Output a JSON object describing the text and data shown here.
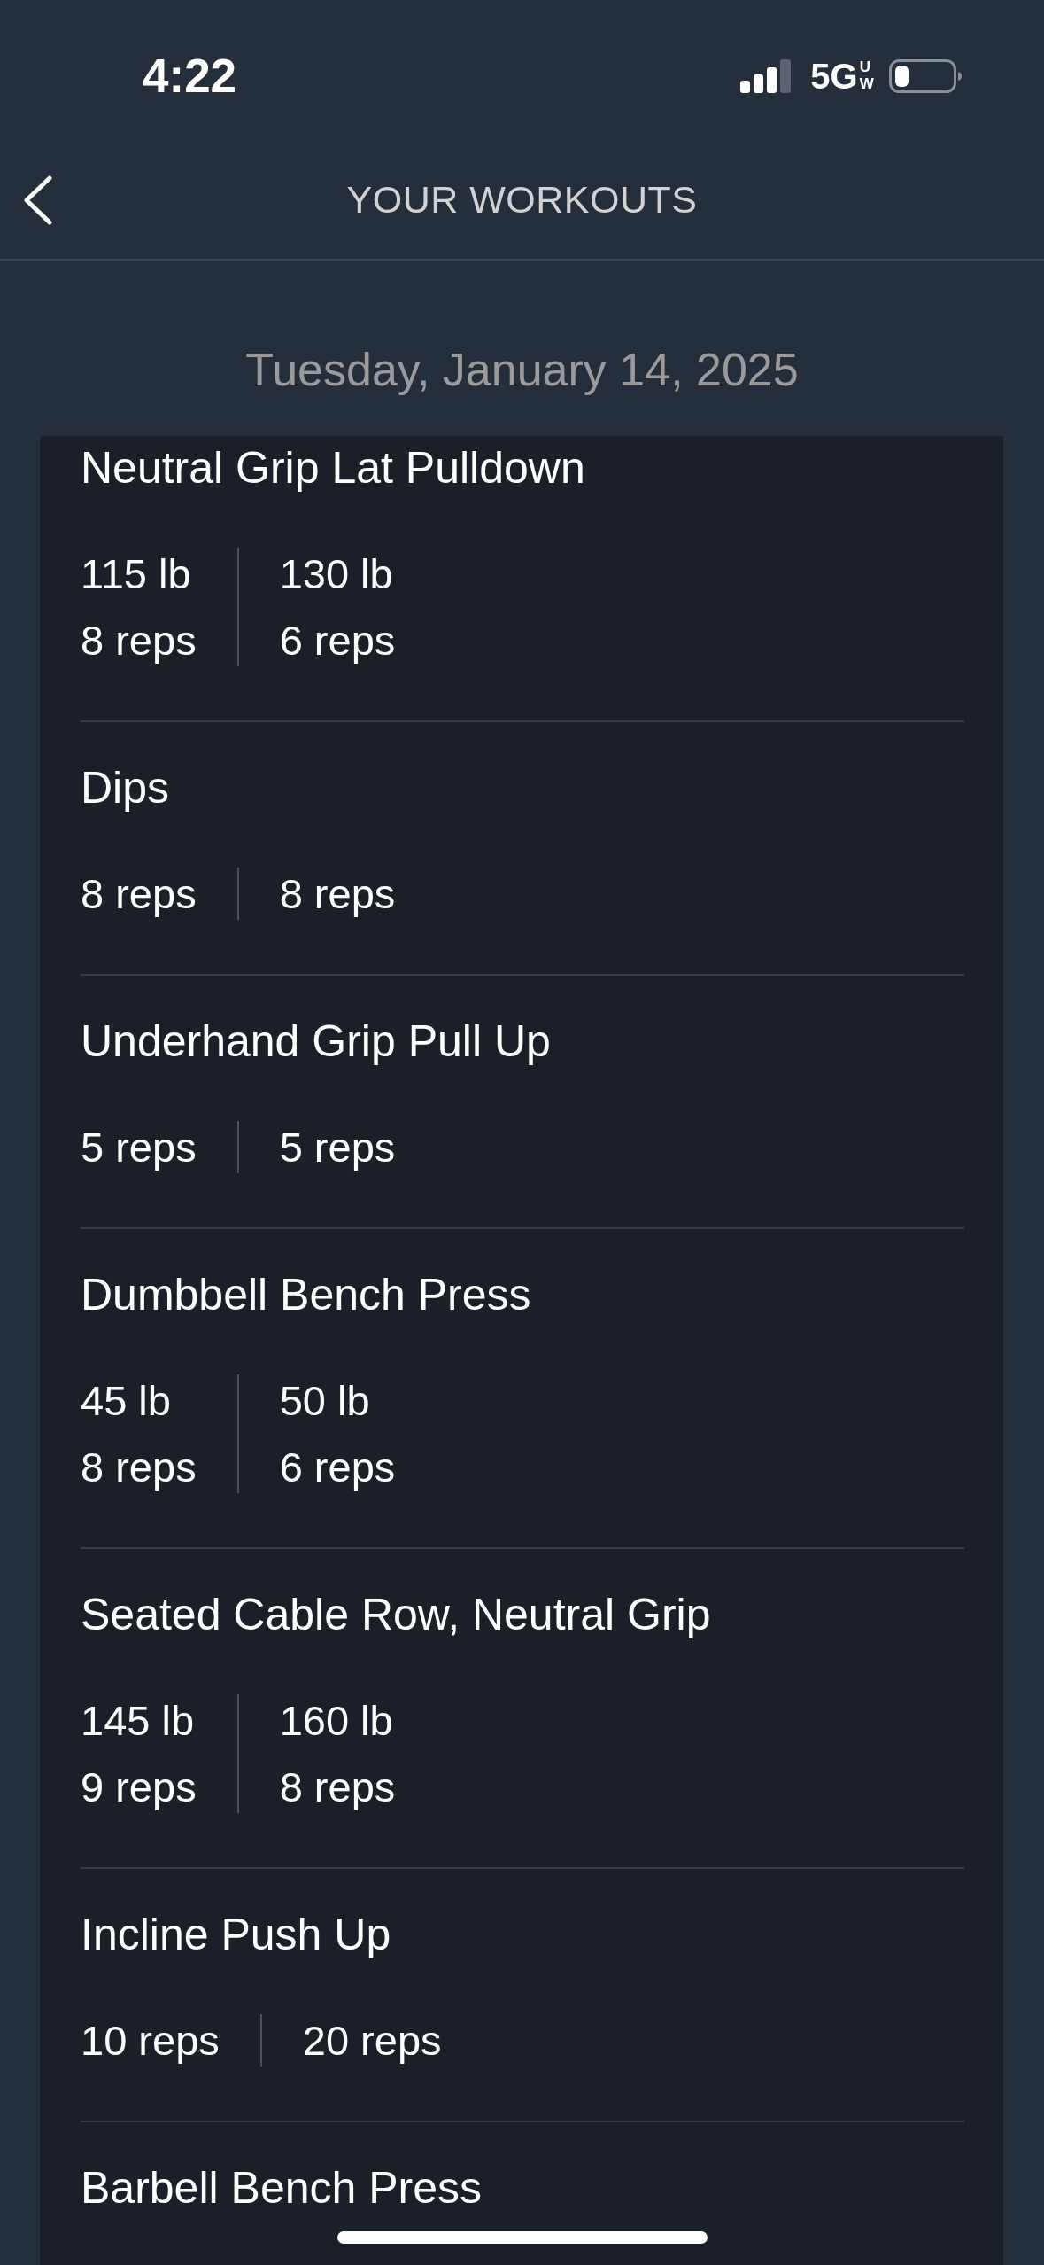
{
  "status_bar": {
    "time": "4:22",
    "network": "5G",
    "network_suffix": "UW"
  },
  "header": {
    "title": "YOUR WORKOUTS"
  },
  "date": "Tuesday, January 14, 2025",
  "exercises": [
    {
      "name": "Neutral Grip Lat Pulldown",
      "sets": [
        {
          "weight": "115 lb",
          "reps": "8 reps"
        },
        {
          "weight": "130 lb",
          "reps": "6 reps"
        }
      ]
    },
    {
      "name": "Dips",
      "sets": [
        {
          "reps": "8 reps"
        },
        {
          "reps": "8 reps"
        }
      ]
    },
    {
      "name": "Underhand Grip Pull Up",
      "sets": [
        {
          "reps": "5 reps"
        },
        {
          "reps": "5 reps"
        }
      ]
    },
    {
      "name": "Dumbbell Bench Press",
      "sets": [
        {
          "weight": "45 lb",
          "reps": "8 reps"
        },
        {
          "weight": "50 lb",
          "reps": "6 reps"
        }
      ]
    },
    {
      "name": "Seated Cable Row, Neutral Grip",
      "sets": [
        {
          "weight": "145 lb",
          "reps": "9 reps"
        },
        {
          "weight": "160 lb",
          "reps": "8 reps"
        }
      ]
    },
    {
      "name": "Incline Push Up",
      "sets": [
        {
          "reps": "10 reps"
        },
        {
          "reps": "20 reps"
        }
      ]
    },
    {
      "name": "Barbell Bench Press"
    }
  ]
}
